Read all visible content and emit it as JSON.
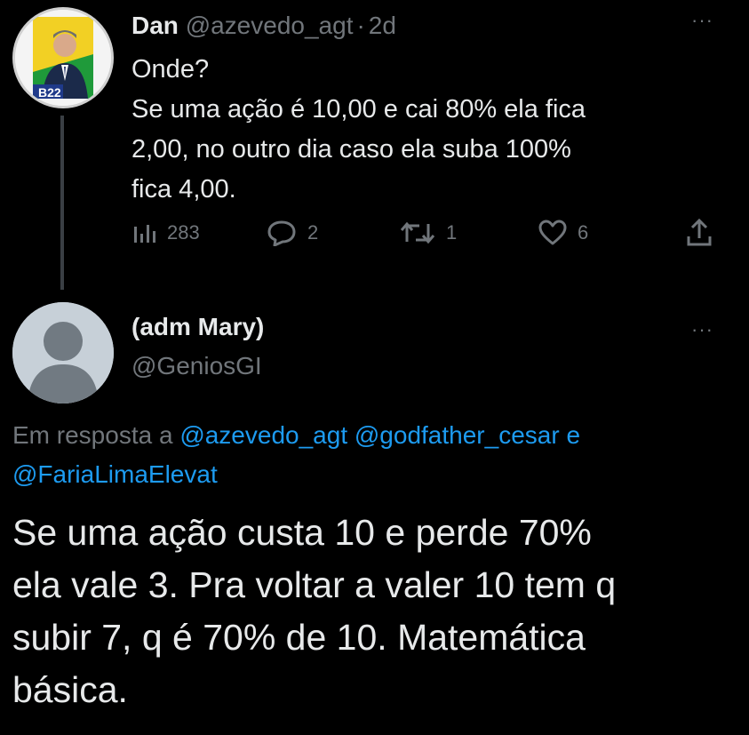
{
  "parent_tweet": {
    "display_name": "Dan",
    "handle": "@azevedo_agt",
    "separator": "·",
    "time": "2d",
    "more": "···",
    "avatar_badge": "B22",
    "text_lines": [
      "Onde?",
      "Se uma ação é 10,00 e cai 80% ela fica",
      "2,00, no outro dia caso ela suba 100%",
      "fica 4,00."
    ],
    "stats": {
      "views": "283",
      "replies": "2",
      "retweets": "1",
      "likes": "6"
    },
    "icons": [
      "views-icon",
      "reply-icon",
      "retweet-icon",
      "like-icon",
      "share-icon"
    ]
  },
  "reply_tweet": {
    "display_name": "(adm Mary)",
    "handle": "@GeniosGI",
    "more": "···",
    "reply_prefix": "Em resposta a",
    "mentions": [
      "@azevedo_agt",
      "@godfather_cesar",
      "@FariaLimaElevat"
    ],
    "reply_joiner": "e",
    "text_lines": [
      "Se uma ação custa 10 e perde 70%",
      "ela vale 3. Pra voltar a valer 10 tem q",
      "subir 7, q é 70% de 10. Matemática",
      "básica."
    ]
  },
  "colors": {
    "background": "#000000",
    "primary_text": "#e7e9ea",
    "secondary_text": "#71767b",
    "link": "#1d9bf0",
    "avatar_green": "#1f9a3a",
    "avatar_yellow": "#f2d024"
  }
}
